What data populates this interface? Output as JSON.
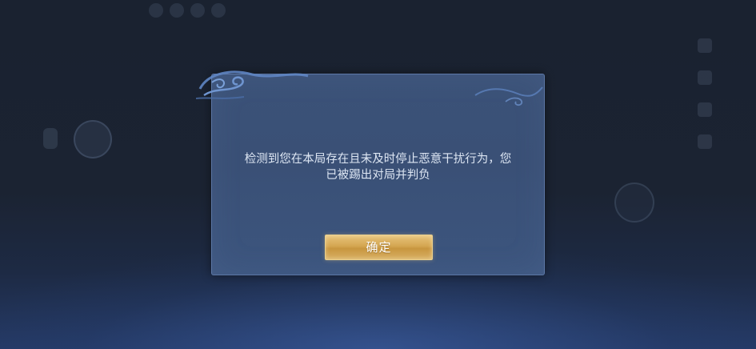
{
  "dialog": {
    "message_line1": "检测到您在本局存在且未及时停止恶意干扰行为，您",
    "message_line2": "已被踢出对局并判负",
    "confirm_label": "确定"
  },
  "colors": {
    "dialog_bg": "#3b5278",
    "button_gold": "#d4a651",
    "text": "#dde6f3"
  },
  "icons": [
    "cloud-ornament-icon"
  ]
}
